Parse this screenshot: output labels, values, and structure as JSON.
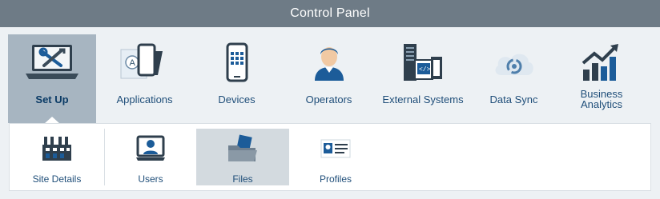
{
  "window": {
    "title": "Control Panel"
  },
  "nav": [
    {
      "id": "setup",
      "label": "Set Up",
      "icon": "laptop-tools-icon",
      "active": true
    },
    {
      "id": "apps",
      "label": "Applications",
      "icon": "applications-icon",
      "active": false
    },
    {
      "id": "devices",
      "label": "Devices",
      "icon": "phone-icon",
      "active": false
    },
    {
      "id": "operators",
      "label": "Operators",
      "icon": "operator-icon",
      "active": false
    },
    {
      "id": "ext",
      "label": "External Systems",
      "icon": "server-icon",
      "active": false
    },
    {
      "id": "sync",
      "label": "Data Sync",
      "icon": "cloud-sync-icon",
      "active": false
    },
    {
      "id": "analytics",
      "label": "Business\nAnalytics",
      "icon": "chart-growth-icon",
      "active": false
    }
  ],
  "subnav": [
    {
      "id": "site",
      "label": "Site Details",
      "icon": "factory-icon",
      "active": false
    },
    {
      "id": "users",
      "label": "Users",
      "icon": "user-monitor-icon",
      "active": false
    },
    {
      "id": "files",
      "label": "Files",
      "icon": "folder-file-icon",
      "active": true
    },
    {
      "id": "profiles",
      "label": "Profiles",
      "icon": "id-card-icon",
      "active": false
    }
  ],
  "colors": {
    "titlebar": "#6e7b86",
    "active_tab": "#a7b5c1",
    "active_sub": "#d3dadf",
    "label": "#1f4e79",
    "background": "#edf1f4"
  }
}
